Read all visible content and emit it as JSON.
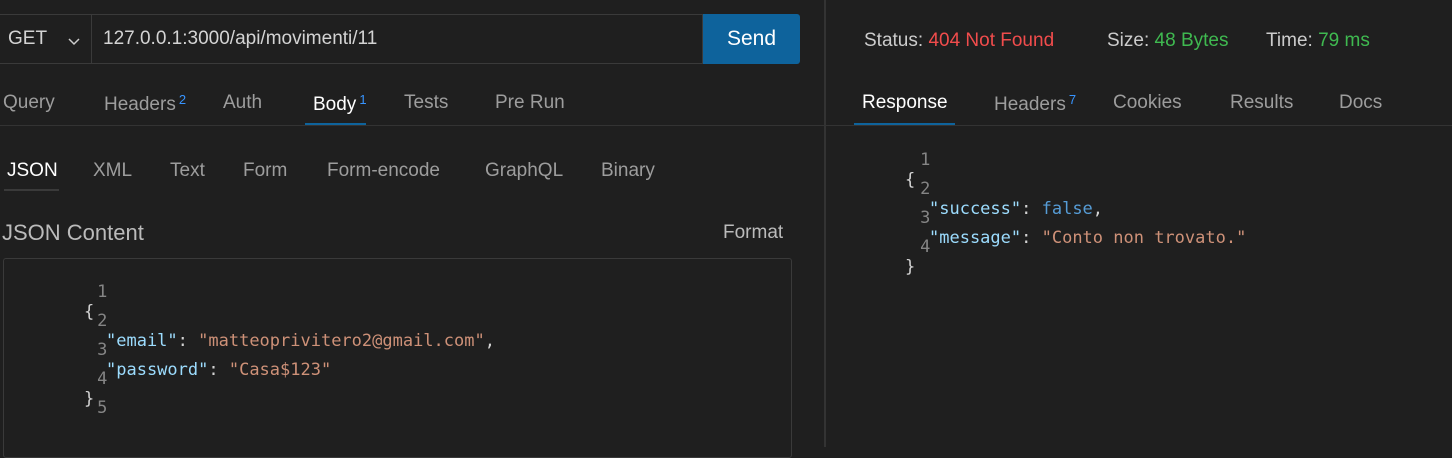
{
  "request": {
    "method": "GET",
    "url": "127.0.0.1:3000/api/movimenti/11",
    "send_label": "Send"
  },
  "request_tabs": [
    {
      "label": "Query",
      "badge": ""
    },
    {
      "label": "Headers",
      "badge": "2"
    },
    {
      "label": "Auth",
      "badge": ""
    },
    {
      "label": "Body",
      "badge": "1"
    },
    {
      "label": "Tests",
      "badge": ""
    },
    {
      "label": "Pre Run",
      "badge": ""
    }
  ],
  "body_tabs": [
    "JSON",
    "XML",
    "Text",
    "Form",
    "Form-encode",
    "GraphQL",
    "Binary"
  ],
  "body": {
    "title": "JSON Content",
    "format_label": "Format",
    "lines": [
      {
        "n": "1",
        "text": "{"
      },
      {
        "n": "2",
        "key": "\"email\"",
        "sep": ": ",
        "val": "\"matteoprivitero2@gmail.com\"",
        "end": ","
      },
      {
        "n": "3",
        "key": "\"password\"",
        "sep": ": ",
        "val": "\"Casa$123\"",
        "end": ""
      },
      {
        "n": "4",
        "text": "}"
      },
      {
        "n": "5",
        "text": ""
      }
    ]
  },
  "response": {
    "status_label": "Status:",
    "status_value": "404 Not Found",
    "size_label": "Size:",
    "size_value": "48 Bytes",
    "time_label": "Time:",
    "time_value": "79 ms",
    "tabs": [
      {
        "label": "Response",
        "badge": ""
      },
      {
        "label": "Headers",
        "badge": "7"
      },
      {
        "label": "Cookies",
        "badge": ""
      },
      {
        "label": "Results",
        "badge": ""
      },
      {
        "label": "Docs",
        "badge": ""
      }
    ],
    "lines": [
      {
        "n": "1",
        "text": "{"
      },
      {
        "n": "2",
        "key": "\"success\"",
        "sep": ": ",
        "val": "false",
        "end": ","
      },
      {
        "n": "3",
        "key": "\"message\"",
        "sep": ": ",
        "val": "\"Conto non trovato.\"",
        "end": ""
      },
      {
        "n": "4",
        "text": "}"
      }
    ]
  },
  "colors": {
    "accent": "#0e639c",
    "badge": "#3794ff",
    "error": "#f14c4c",
    "success": "#3fb950"
  }
}
